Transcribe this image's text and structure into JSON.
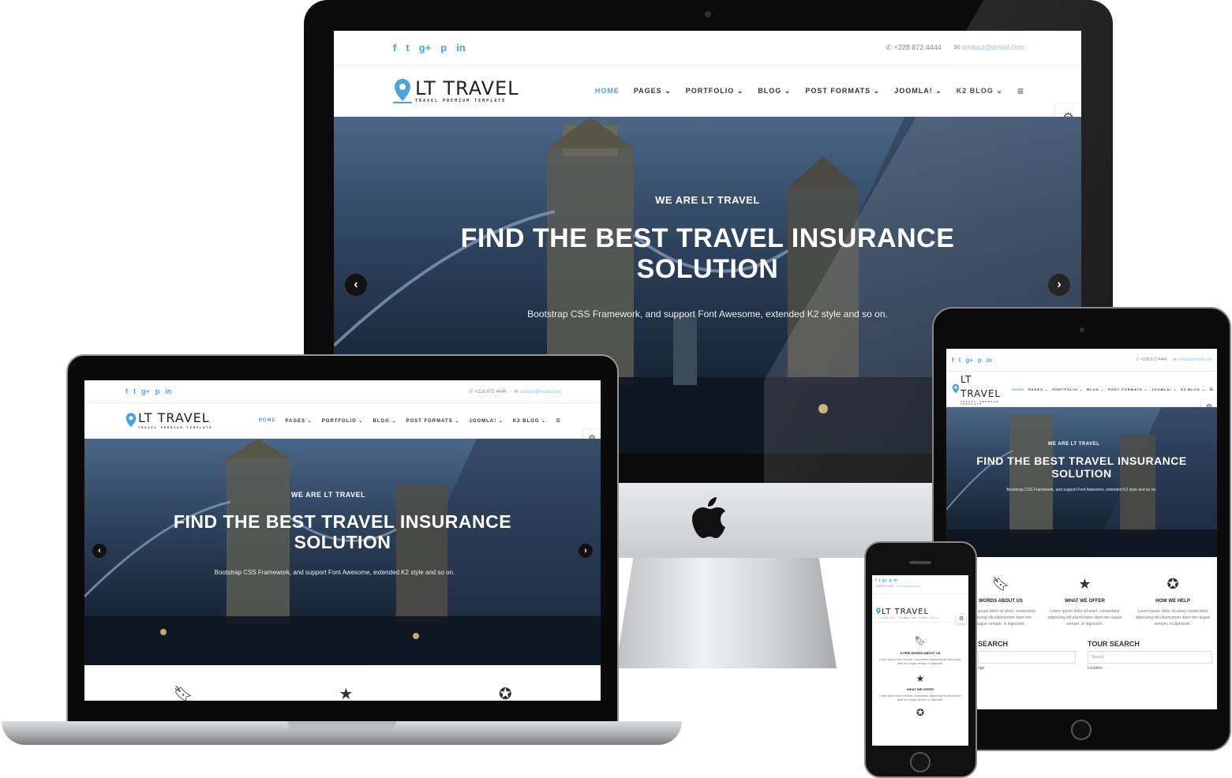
{
  "site": {
    "logo_text": "LT TRAVEL",
    "logo_tagline": "TRAVEL PREMIUM TEMPLATE",
    "phone": "+228 872 4444",
    "email": "contact@email.com",
    "menu": [
      "HOME",
      "PAGES",
      "PORTFOLIO",
      "BLOG",
      "POST FORMATS",
      "JOOMLA!",
      "K2 BLOG"
    ],
    "hero": {
      "kicker": "WE ARE LT TRAVEL",
      "title": "FIND THE BEST TRAVEL INSURANCE SOLUTION",
      "subtitle": "Bootstrap CSS Framework, and support Font Awesome, extended K2 style and so on."
    },
    "features": [
      {
        "icon": "bookmark-icon",
        "title_tablet": "WORDS ABOUT US",
        "title_phone": "A FEW WORDS ABOUT US",
        "text": "Lorem ipsum dolor sit amet, consectetur adipiscing elit.ullamcorper diam nec augue semper, in dignissim."
      },
      {
        "icon": "star-icon",
        "title_tablet": "WHAT WE OFFER",
        "title_phone": "WHAT WE OFFER",
        "text": "Lorem ipsum dolor sit amet, consectetur adipiscing elit.ullamcorper diam nec augue semper, in dignissim."
      },
      {
        "icon": "rebel-icon",
        "title_tablet": "HOW WE HELP",
        "text": "Lorem ipsum dolor sit amet, consectetur adipiscing elit.ullamcorper diam nec augue semper, in dignissim."
      }
    ],
    "search": {
      "search_label": "SEARCH",
      "tour_search_label": "TOUR SEARCH",
      "placeholder": "Search",
      "location_label": "Location",
      "range_label": "nge"
    }
  },
  "colors": {
    "accent": "#4aa3df",
    "dark": "#0b0b0b"
  }
}
